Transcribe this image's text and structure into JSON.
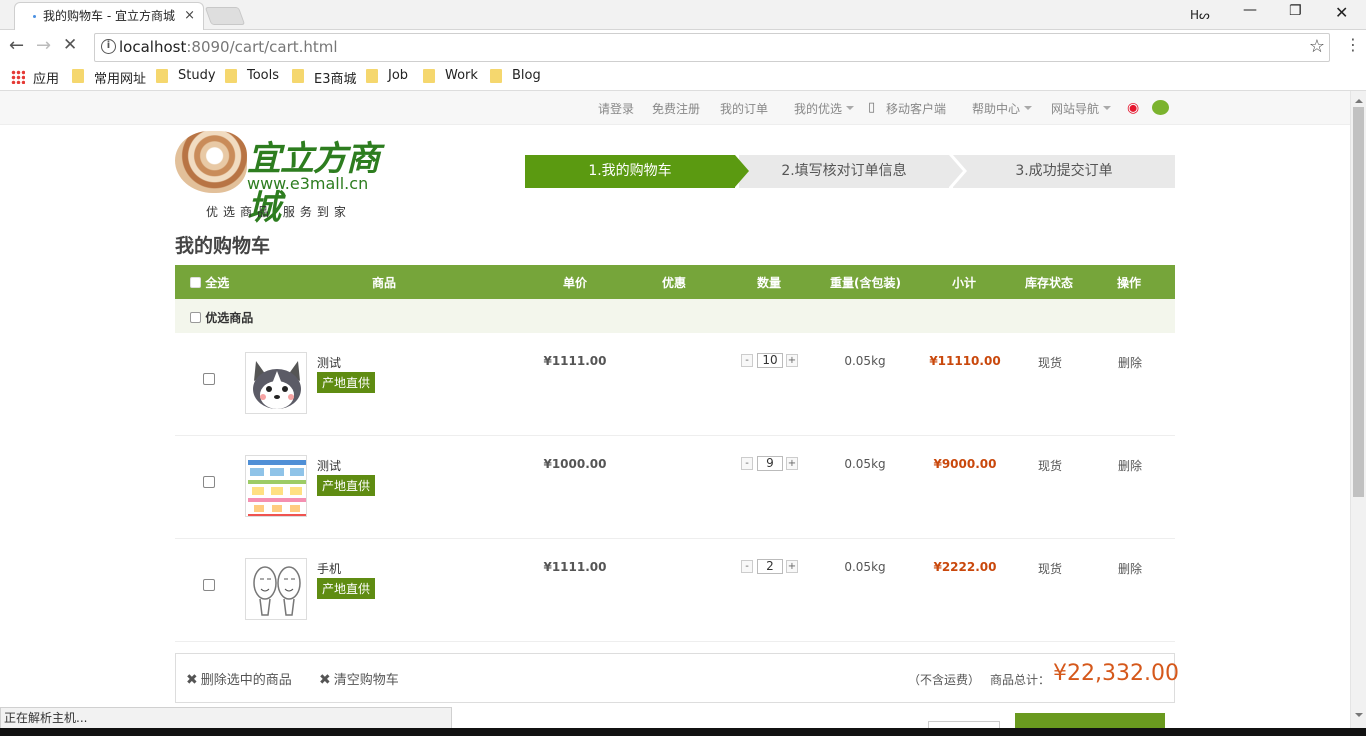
{
  "browser": {
    "tab_title": "我的购物车 - 宜立方商城",
    "tab_close": "×",
    "url_host": "localhost",
    "url_rest": ":8090/cart/cart.html",
    "bookmarks": [
      "应用",
      "常用网址",
      "Study",
      "Tools",
      "E3商城",
      "Job",
      "Work",
      "Blog"
    ],
    "status_text": "正在解析主机..."
  },
  "topnav": {
    "items": [
      "请登录",
      "免费注册",
      "我的订单",
      "我的优选",
      "移动客户端",
      "帮助中心",
      "网站导航"
    ]
  },
  "logo": {
    "brand": "宜立方商城",
    "site": "www.e3mall.cn",
    "slogan": "优选商品   服务到家"
  },
  "steps": [
    "1.我的购物车",
    "2.填写核对订单信息",
    "3.成功提交订单"
  ],
  "page_title": "我的购物车",
  "table": {
    "headers": {
      "select_all": "全选",
      "product": "商品",
      "unit_price": "单价",
      "discount": "优惠",
      "quantity": "数量",
      "weight": "重量(含包装)",
      "subtotal": "小计",
      "stock": "库存状态",
      "action": "操作"
    },
    "group_label": "优选商品",
    "rows": [
      {
        "name": "测试",
        "tag": "产地直供",
        "price": "¥1111.00",
        "qty": "10",
        "weight": "0.05kg",
        "subtotal": "¥11110.00",
        "stock": "现货",
        "action": "删除"
      },
      {
        "name": "测试",
        "tag": "产地直供",
        "price": "¥1000.00",
        "qty": "9",
        "weight": "0.05kg",
        "subtotal": "¥9000.00",
        "stock": "现货",
        "action": "删除"
      },
      {
        "name": "手机",
        "tag": "产地直供",
        "price": "¥1111.00",
        "qty": "2",
        "weight": "0.05kg",
        "subtotal": "¥2222.00",
        "stock": "现货",
        "action": "删除"
      }
    ],
    "qty_minus": "-",
    "qty_plus": "+"
  },
  "footer": {
    "delete_selected": "删除选中的商品",
    "clear_cart": "清空购物车",
    "shipping_note": "（不含运费）",
    "total_label": "商品总计：",
    "total_value": "¥22,332.00"
  },
  "colors": {
    "accent_green": "#76a53a",
    "step_green": "#5b9a11",
    "price_orange": "#c9480c"
  }
}
